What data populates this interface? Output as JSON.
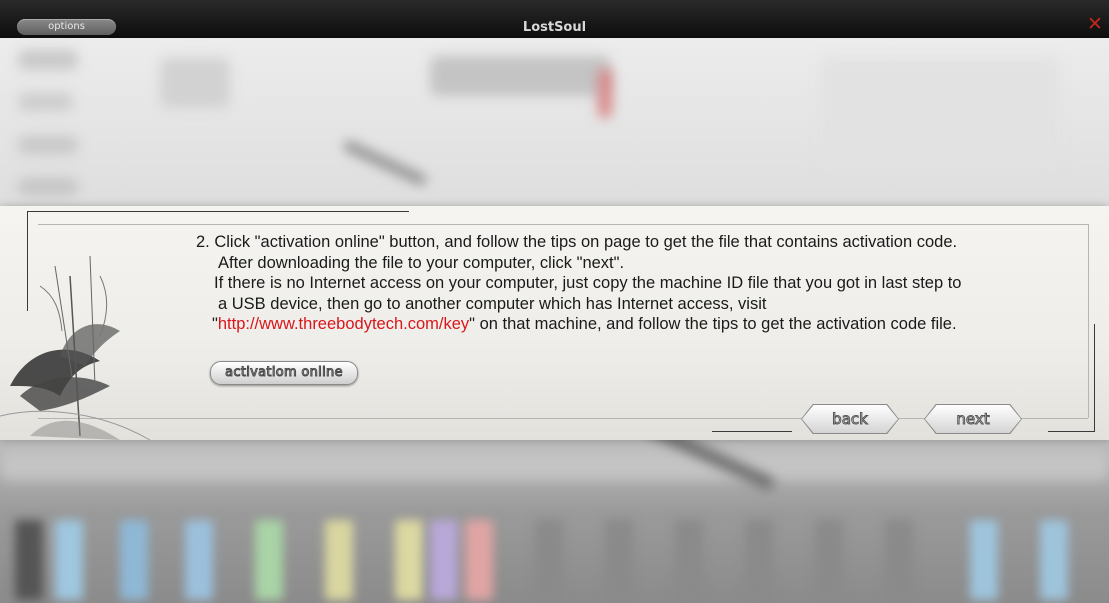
{
  "window": {
    "title": "LostSoul",
    "options_label": "options",
    "close_icon": "close-icon",
    "accent_close": "#c0271f"
  },
  "dialog": {
    "lines": [
      "2. Click \"activation online\" button, and follow the tips on page to get the file that contains activation code.",
      "After downloading the file to your computer, click \"next\".",
      "If there is no Internet access on your computer, just copy the machine ID file that you got in last step to",
      "a USB device, then go to another computer which has Internet access, visit"
    ],
    "url_quote_open": "\"",
    "url": "http://www.threebodytech.com/key",
    "url_tail": "\" on that machine, and follow the tips to get the activation code file.",
    "url_color": "#d8161b",
    "activation_button": "activatiom online",
    "back_button": "back",
    "next_button": "next"
  }
}
